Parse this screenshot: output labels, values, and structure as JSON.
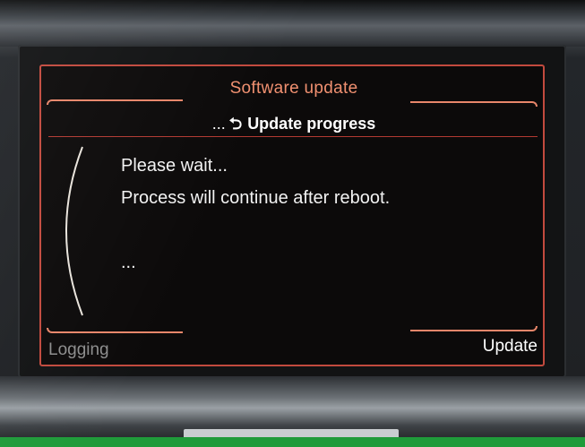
{
  "screen": {
    "title": "Software update",
    "subtitle_prefix": "...",
    "back_glyph": "⮌",
    "subtitle": "Update progress",
    "messages": [
      "Please wait...",
      "Process will continue after reboot.",
      "..."
    ],
    "softkey_left": "Logging",
    "softkey_right": "Update"
  },
  "colors": {
    "accent": "#e8866a",
    "frame": "#c24a3e",
    "title_text": "#f09070",
    "text": "#f2f2f2",
    "inactive_text": "#8e8e8e"
  },
  "icons": {
    "back": "back-arrow-icon"
  }
}
